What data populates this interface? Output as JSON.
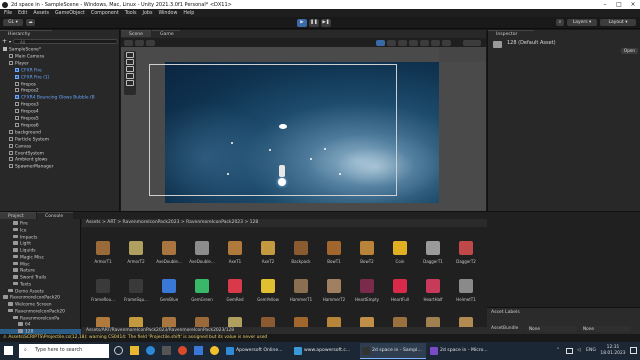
{
  "window": {
    "title": "2d space in - SampleScene - Windows, Mac, Linux - Unity 2021.3.0f1 Personal* <DX11>"
  },
  "menu": [
    "File",
    "Edit",
    "Assets",
    "GameObject",
    "Component",
    "Tools",
    "Jobs",
    "Window",
    "Help"
  ],
  "toolbar": {
    "account": "GL",
    "layers": "Layers",
    "layout": "Layout"
  },
  "hierarchy": {
    "tab": "Hierarchy",
    "search_placeholder": "All",
    "add": "+",
    "items": [
      {
        "label": "SampleScene*",
        "indent": 0,
        "type": "scene"
      },
      {
        "label": "Main Camera",
        "indent": 1,
        "type": "object"
      },
      {
        "label": "Player",
        "indent": 1,
        "type": "object"
      },
      {
        "label": "CFXR Fire",
        "indent": 2,
        "type": "prefab"
      },
      {
        "label": "CFXR Fire (1)",
        "indent": 2,
        "type": "prefab"
      },
      {
        "label": "firepos",
        "indent": 2,
        "type": "object"
      },
      {
        "label": "firepos2",
        "indent": 2,
        "type": "object"
      },
      {
        "label": "CFXR4 Bouncing Glows Bubble (B",
        "indent": 2,
        "type": "prefab"
      },
      {
        "label": "firepos3",
        "indent": 2,
        "type": "object"
      },
      {
        "label": "firepos4",
        "indent": 2,
        "type": "object"
      },
      {
        "label": "firepos5",
        "indent": 2,
        "type": "object"
      },
      {
        "label": "firepos6",
        "indent": 2,
        "type": "object"
      },
      {
        "label": "background",
        "indent": 1,
        "type": "object"
      },
      {
        "label": "Particle System",
        "indent": 1,
        "type": "object"
      },
      {
        "label": "Canvas",
        "indent": 1,
        "type": "object"
      },
      {
        "label": "EventSystem",
        "indent": 1,
        "type": "object"
      },
      {
        "label": "Ambient glows",
        "indent": 1,
        "type": "object"
      },
      {
        "label": "SpawnerManager",
        "indent": 1,
        "type": "object"
      }
    ]
  },
  "scene_view": {
    "tabs": [
      "Scene",
      "Game"
    ],
    "active_tab": "Scene"
  },
  "inspector": {
    "tab": "Inspector",
    "asset_name": "128 (Default Asset)",
    "open_label": "Open"
  },
  "project": {
    "tabs": [
      "Project",
      "Console"
    ],
    "path_top": "Assets > ART > RavenmoreIconPack2023 > RavenmoreIconPack2023 > 128",
    "tree": [
      {
        "label": "Fire",
        "indent": 2
      },
      {
        "label": "Ice",
        "indent": 2
      },
      {
        "label": "Impacts",
        "indent": 2
      },
      {
        "label": "Light",
        "indent": 2
      },
      {
        "label": "Liquids",
        "indent": 2
      },
      {
        "label": "Magic Misc",
        "indent": 2
      },
      {
        "label": "Misc",
        "indent": 2
      },
      {
        "label": "Nature",
        "indent": 2
      },
      {
        "label": "Sword Trails",
        "indent": 2
      },
      {
        "label": "Texts",
        "indent": 2
      },
      {
        "label": "Demo Assets",
        "indent": 1
      },
      {
        "label": "RavenmoreIconPack20",
        "indent": 0
      },
      {
        "label": "Welcome Screen",
        "indent": 1
      },
      {
        "label": "RavenmoreIconPack20",
        "indent": 1
      },
      {
        "label": "RavenmoreIconPa",
        "indent": 2
      },
      {
        "label": "64",
        "indent": 3
      },
      {
        "label": "128",
        "indent": 3
      }
    ],
    "items_row1": [
      {
        "label": "ArmorT1",
        "color": "#9a6a3a"
      },
      {
        "label": "ArmorT2",
        "color": "#b0a060"
      },
      {
        "label": "AxeDouble...",
        "color": "#a8763e"
      },
      {
        "label": "AxeDouble...",
        "color": "#8c8c8c"
      },
      {
        "label": "AxeT1",
        "color": "#b07a3c"
      },
      {
        "label": "AxeT2",
        "color": "#c49a40"
      },
      {
        "label": "Backpack",
        "color": "#8a5a30"
      },
      {
        "label": "BowT1",
        "color": "#a0662e"
      },
      {
        "label": "BowT2",
        "color": "#b8843a"
      },
      {
        "label": "Coin",
        "color": "#e0b020"
      },
      {
        "label": "DaggerT1",
        "color": "#9a9a9a"
      },
      {
        "label": "DaggerT2",
        "color": "#c04848"
      }
    ],
    "items_row2": [
      {
        "label": "FrameRou...",
        "color": "#3a3a3a"
      },
      {
        "label": "FrameSqu...",
        "color": "#3a3a3a"
      },
      {
        "label": "GemBlue",
        "color": "#3a78d8"
      },
      {
        "label": "GemGreen",
        "color": "#3ab86a"
      },
      {
        "label": "GemRed",
        "color": "#d83a4a"
      },
      {
        "label": "GemYellow",
        "color": "#e0c030"
      },
      {
        "label": "HammerT1",
        "color": "#8a7050"
      },
      {
        "label": "HammerT2",
        "color": "#a08060"
      },
      {
        "label": "HeartEmpty",
        "color": "#7a2a4a"
      },
      {
        "label": "HeartFull",
        "color": "#d82a4a"
      },
      {
        "label": "HeartHalf",
        "color": "#c83a5a"
      },
      {
        "label": "HelmetT1",
        "color": "#8a8a8a"
      }
    ],
    "items_row3_colors": [
      "#b07a3c",
      "#c49a40",
      "#a8763e",
      "#9a6a3a",
      "#b0a060",
      "#8a5a30",
      "#a0662e",
      "#b8843a",
      "#c09048",
      "#9a7040",
      "#a08050",
      "#b08a50"
    ],
    "path_bottom": "Assets/ART/RavenmoreIconPack2023/RavenmoreIconPack2023/128"
  },
  "asset_labels": {
    "title": "Asset Labels",
    "bundle_label": "AssetBundle",
    "bundle_value": "None",
    "variant_value": "None"
  },
  "status": {
    "warning": "Assets\\SCRIPTS\\Projectile.cs(12,18): warning CS0414: The field 'Projectile.shift' is assigned but its value is never used"
  },
  "taskbar": {
    "search_placeholder": "Type here to search",
    "apps": [
      {
        "label": "Apowersoft Online...",
        "color": "#2f8ad8"
      },
      {
        "label": "www.apowersoft.c...",
        "color": "#3a9ad8"
      },
      {
        "label": "2d space in - Sampl...",
        "color": "#333333"
      },
      {
        "label": "2d space in - Micro...",
        "color": "#7a4ac8"
      }
    ],
    "lang": "ENG",
    "time": "12:31",
    "date": "18.01.2023"
  }
}
